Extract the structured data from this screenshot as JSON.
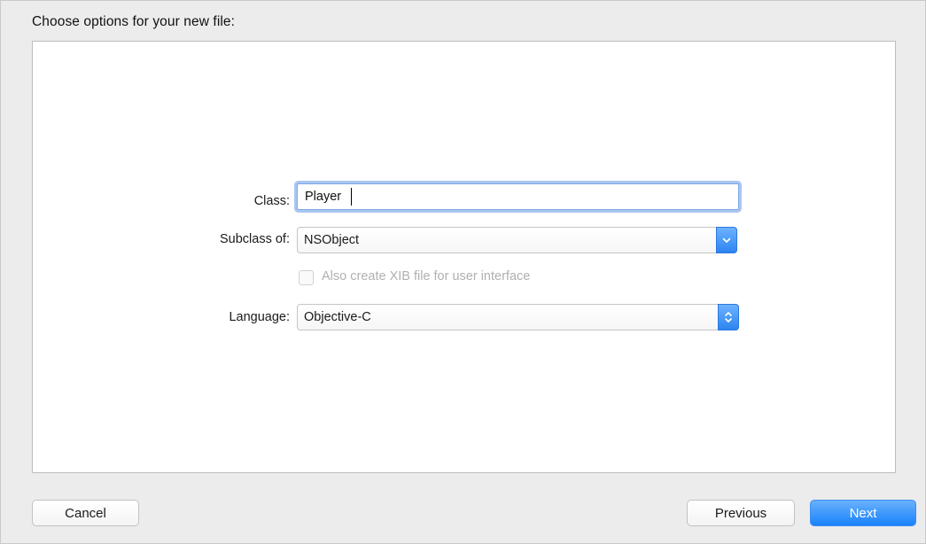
{
  "dialog": {
    "header_title": "Choose options for your new file:"
  },
  "form": {
    "class_label": "Class:",
    "class_value": "Player",
    "subclass_label": "Subclass of:",
    "subclass_value": "NSObject",
    "subclass_button_icon": "chevron-down-icon",
    "xib_checkbox_label": "Also create XIB file for user interface",
    "xib_checkbox_checked": false,
    "xib_checkbox_enabled": false,
    "language_label": "Language:",
    "language_value": "Objective-C",
    "language_button_icon": "up-down-chevron-icon"
  },
  "footer": {
    "cancel_label": "Cancel",
    "previous_label": "Previous",
    "next_label": "Next"
  },
  "colors": {
    "accent": "#2d84f1",
    "focus_ring": "#a9c6f1",
    "disabled_text": "#b0b0b0"
  }
}
